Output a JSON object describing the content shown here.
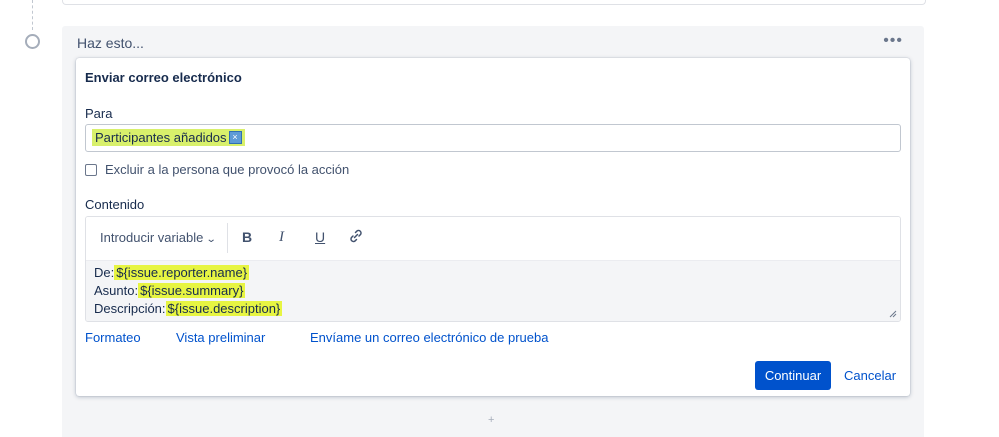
{
  "action": {
    "title": "Haz esto...",
    "more": "•••",
    "add": "+"
  },
  "email": {
    "heading": "Enviar correo electrónico",
    "to_label": "Para",
    "to_tag": "Participantes añadidos",
    "to_tag_remove": "×",
    "exclude_label": "Excluir a la persona que provocó la acción",
    "content_label": "Contenido",
    "toolbar": {
      "insert_variable": "Introducir variable",
      "bold": "B",
      "italic": "I",
      "underline": "U",
      "link_icon": "link-icon"
    },
    "content_lines": [
      {
        "prefix": "De:",
        "variable": "${issue.reporter.name}"
      },
      {
        "prefix": "Asunto: ",
        "variable": "${issue.summary}"
      },
      {
        "prefix": "Descripción: ",
        "variable": "${issue.description}"
      }
    ],
    "links": {
      "format": "Formateo",
      "preview": "Vista preliminar",
      "test_email": "Envíame un correo electrónico de prueba"
    },
    "buttons": {
      "continue": "Continuar",
      "cancel": "Cancelar"
    }
  },
  "colors": {
    "primary": "#0052cc",
    "highlight": "#e7f542",
    "background": "#f4f5f7"
  }
}
